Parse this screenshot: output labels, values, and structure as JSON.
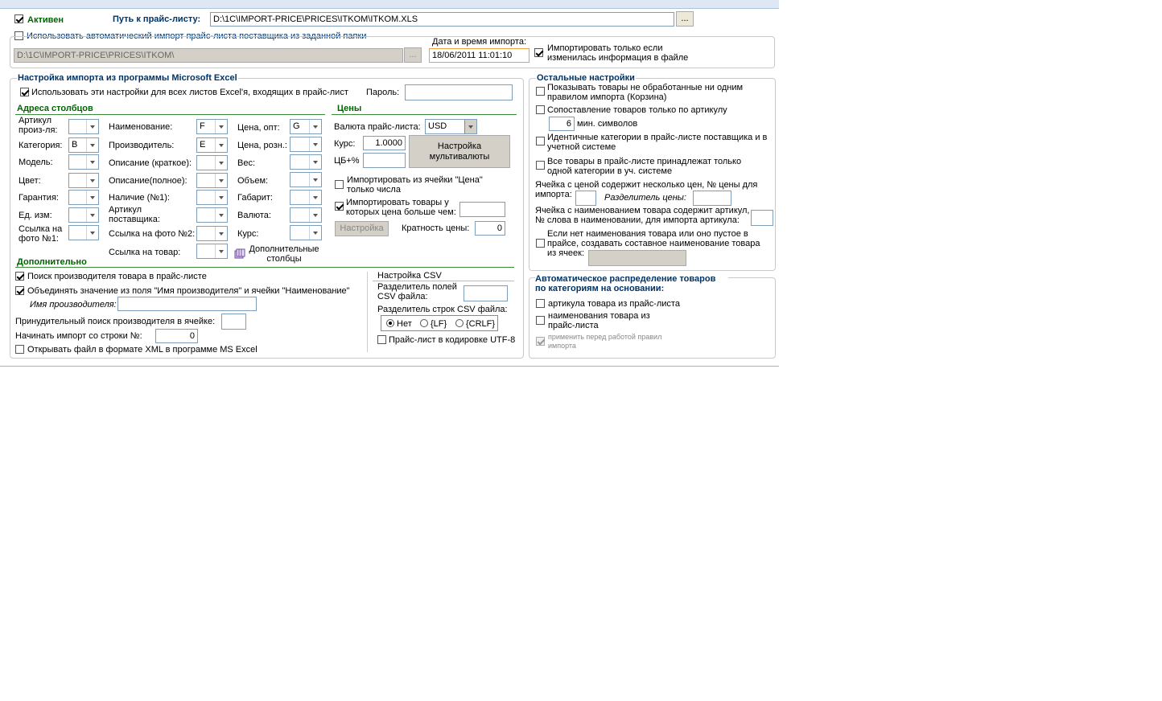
{
  "top": {
    "active_label": "Активен",
    "active_checked": true,
    "path_label": "Путь к прайс-листу:",
    "path_value": "D:\\1C\\IMPORT-PRICE\\PRICES\\ITKOM\\ITKOM.XLS",
    "browse_label": "..."
  },
  "auto_import": {
    "checkbox_label": "Использовать автоматический импорт прайс-листа поставщика из заданной папки",
    "checked": false,
    "folder_value": "D:\\1C\\IMPORT-PRICE\\PRICES\\ITKOM\\",
    "browse_label": "...",
    "datetime_label": "Дата и время импорта:",
    "datetime_value": "18/06/2011 11:01:10",
    "only_if_changed_label": "Импортировать только если изменилась информация в файле",
    "only_if_changed_checked": true
  },
  "excel": {
    "title": "Настройка импорта из программы Microsoft Excel",
    "all_sheets_label": "Использовать эти настройки для всех листов Excel'я, входящих в прайс-лист",
    "all_sheets_checked": true,
    "password_label": "Пароль:",
    "password_value": ""
  },
  "columns": {
    "title": "Адреса столбцов",
    "col1": [
      {
        "label": "Артикул произ-ля:",
        "value": ""
      },
      {
        "label": "Категория:",
        "value": "B"
      },
      {
        "label": "Модель:",
        "value": ""
      },
      {
        "label": "Цвет:",
        "value": ""
      },
      {
        "label": "Гарантия:",
        "value": ""
      },
      {
        "label": "Ед. изм:",
        "value": ""
      },
      {
        "label": "Ссылка на фото №1:",
        "value": ""
      }
    ],
    "col2": [
      {
        "label": "Наименование:",
        "value": "F"
      },
      {
        "label": "Производитель:",
        "value": "E"
      },
      {
        "label": "Описание (краткое):",
        "value": ""
      },
      {
        "label": "Описание(полное):",
        "value": ""
      },
      {
        "label": "Наличие (№1):",
        "value": ""
      },
      {
        "label": "Артикул поставщика:",
        "value": ""
      },
      {
        "label": "Ссылка на фото №2:",
        "value": ""
      },
      {
        "label": "Ссылка на товар:",
        "value": ""
      }
    ],
    "col3": [
      {
        "label": "Цена, опт:",
        "value": "G"
      },
      {
        "label": "Цена, розн.:",
        "value": ""
      },
      {
        "label": "Вес:",
        "value": ""
      },
      {
        "label": "Объем:",
        "value": ""
      },
      {
        "label": "Габарит:",
        "value": ""
      },
      {
        "label": "Валюта:",
        "value": ""
      },
      {
        "label": "Курс:",
        "value": ""
      }
    ],
    "extra_columns_label": "Дополнительные столбцы"
  },
  "prices": {
    "title": "Цены",
    "currency_label": "Валюта прайс-листа:",
    "currency_value": "USD",
    "rate_label": "Курс:",
    "rate_value": "1.0000",
    "cb_label": "ЦБ+%",
    "cb_value": "",
    "multicurrency_button": "Настройка мультивалюты",
    "only_numbers_label": "Импортировать из ячейки \"Цена\" только числа",
    "only_numbers_checked": false,
    "price_greater_label": "Импортировать товары у которых цена больше чем:",
    "price_greater_checked": true,
    "price_greater_value": "",
    "settings_button": "Настройка",
    "multiplicity_label": "Кратность цены:",
    "multiplicity_value": "0"
  },
  "additional": {
    "title": "Дополнительно",
    "search_manufacturer_label": "Поиск производителя товара в прайс-листе",
    "search_manufacturer_checked": true,
    "merge_label": "Объединять значение из поля \"Имя производителя\" и ячейки \"Наименование\"",
    "merge_checked": true,
    "manufacturer_name_label": "Имя производителя:",
    "manufacturer_name_value": "",
    "force_search_label": "Принудительный поиск производителя в ячейке:",
    "force_search_value": "",
    "start_row_label": "Начинать импорт со строки №:",
    "start_row_value": "0",
    "open_xml_label": "Открывать файл в формате XML в программе MS Excel",
    "open_xml_checked": false
  },
  "csv": {
    "title": "Настройка CSV",
    "field_sep_label": "Разделитель полей CSV файла:",
    "field_sep_value": "",
    "row_sep_label": "Разделитель строк CSV файла:",
    "options": [
      "Нет",
      "{LF}",
      "{CRLF}"
    ],
    "selected": "Нет",
    "utf8_label": "Прайс-лист в кодировке UTF-8",
    "utf8_checked": false
  },
  "other": {
    "title": "Остальные настройки",
    "show_unprocessed_label": "Показывать товары не обработанные ни одним правилом импорта (Корзина)",
    "article_match_label": "Сопоставление товаров только по артикулу",
    "min_chars_value": "6",
    "min_chars_label": "мин. символов",
    "identical_categories_label": "Идентичные категории в прайс-листе поставщика и в учетной системе",
    "single_category_label": "Все товары в прайс-листе принадлежат только одной категории в уч. системе",
    "multi_price_label": "Ячейка с ценой содержит несколько цен, № цены для импорта:",
    "multi_price_value": "",
    "price_separator_label": "Разделитель цены:",
    "price_separator_value": "",
    "article_in_name_label": "Ячейка с наименованием товара содержит артикул, № слова в наименовании, для импорта артикула:",
    "article_in_name_value": "",
    "composite_name_label": "Если нет наименования товара или оно пустое в прайсе, создавать составное наименование товара из ячеек:",
    "composite_name_value": ""
  },
  "auto_distribution": {
    "title": "Автоматическое распределение товаров по категориям на основании:",
    "by_article_label": "артикула товара из прайс-листа",
    "by_name_label": "наименования товара из прайс-листа",
    "apply_before_label": "применить перед работой правил импорта",
    "apply_before_checked": true
  }
}
